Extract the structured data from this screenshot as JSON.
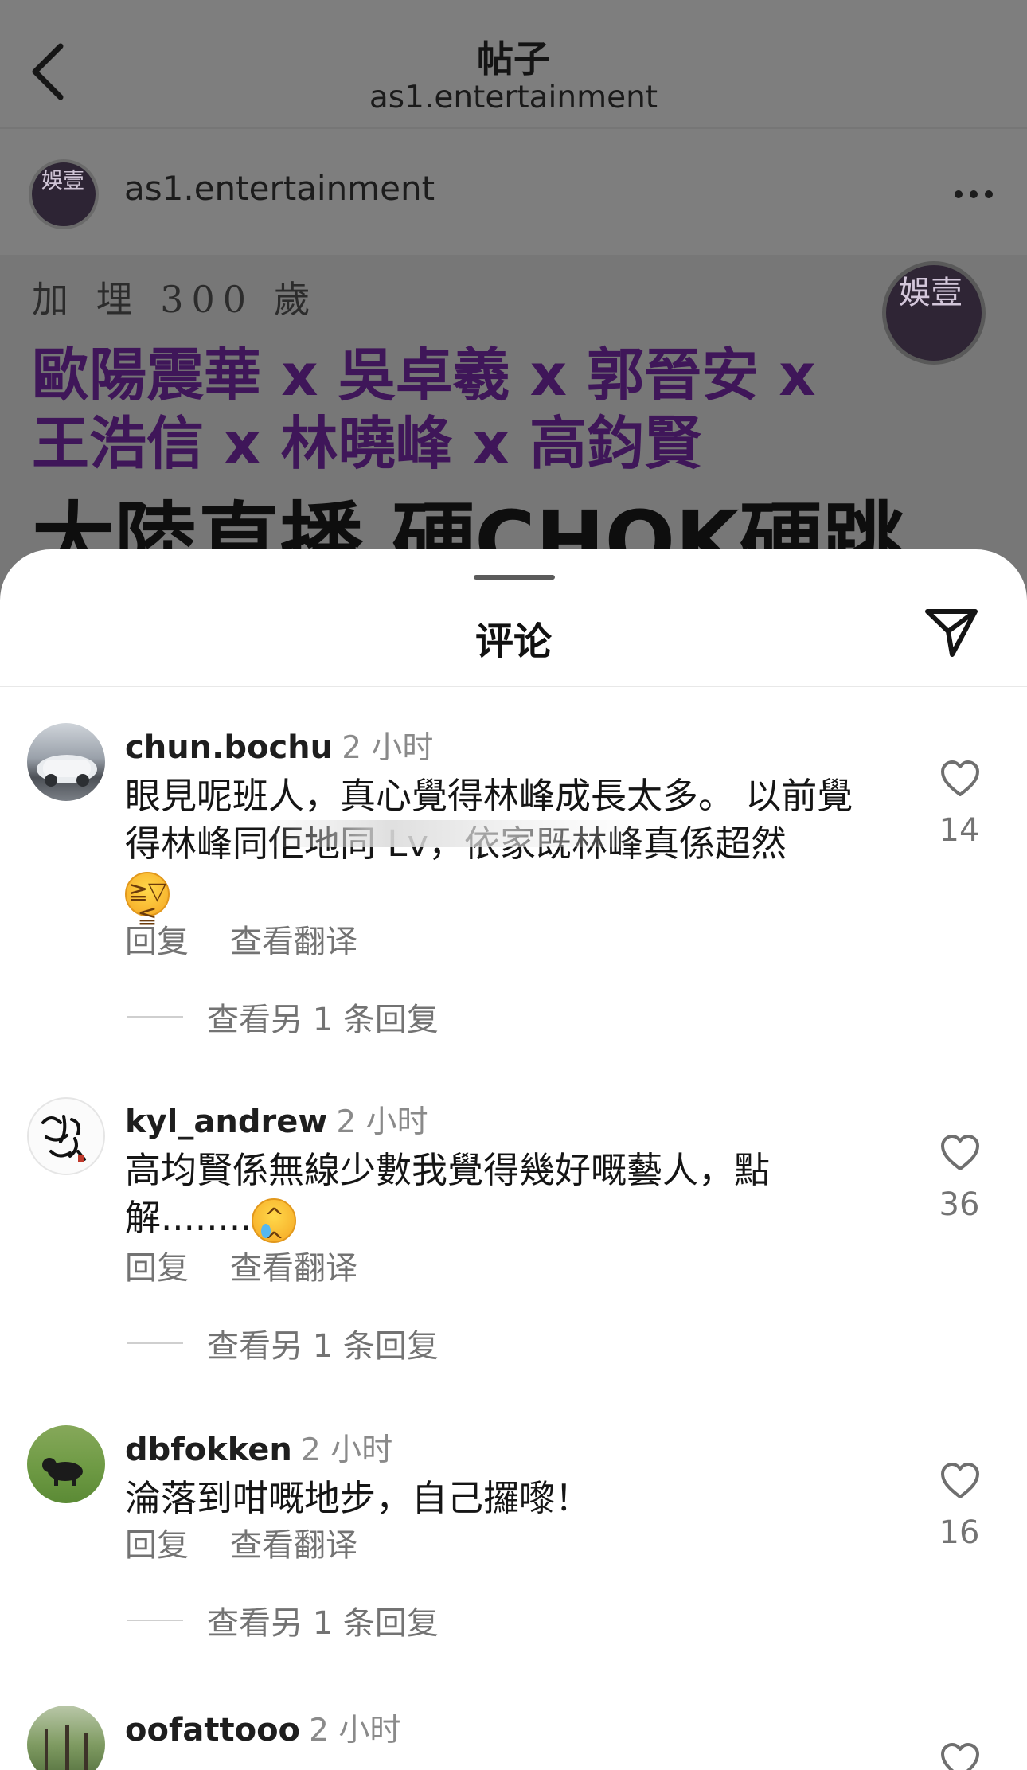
{
  "header": {
    "title": "帖子",
    "subtitle": "as1.entertainment",
    "account_name": "as1.entertainment",
    "logo_text": "娛壹"
  },
  "banner": {
    "small_text": "加 埋 300 歲",
    "line1": "歐陽震華 x 吳卓羲 x 郭晉安 x",
    "line2": "王浩信 x 林曉峰 x 高鈞賢",
    "big_text": "大陸直播 硬CHOK硬跳",
    "logo_text": "娛壹"
  },
  "sheet": {
    "title": "评论"
  },
  "comments": [
    {
      "username": "chun.bochu",
      "time": "2 小时",
      "text": "眼見呢班人，真心覺得林峰成長太多。 以前覺得林峰同佢地同 Lv，依家既林峰真係超然",
      "emoji": "😆",
      "reply_label": "回复",
      "translate_label": "查看翻译",
      "more_replies": "查看另 1 条回复",
      "likes": "14"
    },
    {
      "username": "kyl_andrew",
      "time": "2 小时",
      "text": "高均賢係無線少數我覺得幾好嘅藝人，點解........",
      "emoji": "🥲",
      "reply_label": "回复",
      "translate_label": "查看翻译",
      "more_replies": "查看另 1 条回复",
      "likes": "36"
    },
    {
      "username": "dbfokken",
      "time": "2 小时",
      "text": "淪落到咁嘅地步，自己攞嚟！",
      "reply_label": "回复",
      "translate_label": "查看翻译",
      "more_replies": "查看另 1 条回复",
      "likes": "16"
    },
    {
      "username": "oofattooo",
      "time": "2 小时"
    }
  ],
  "colors": {
    "brand_purple": "#3f1659",
    "dim_overlay": "#7e7e7e",
    "secondary_text": "#737373"
  }
}
